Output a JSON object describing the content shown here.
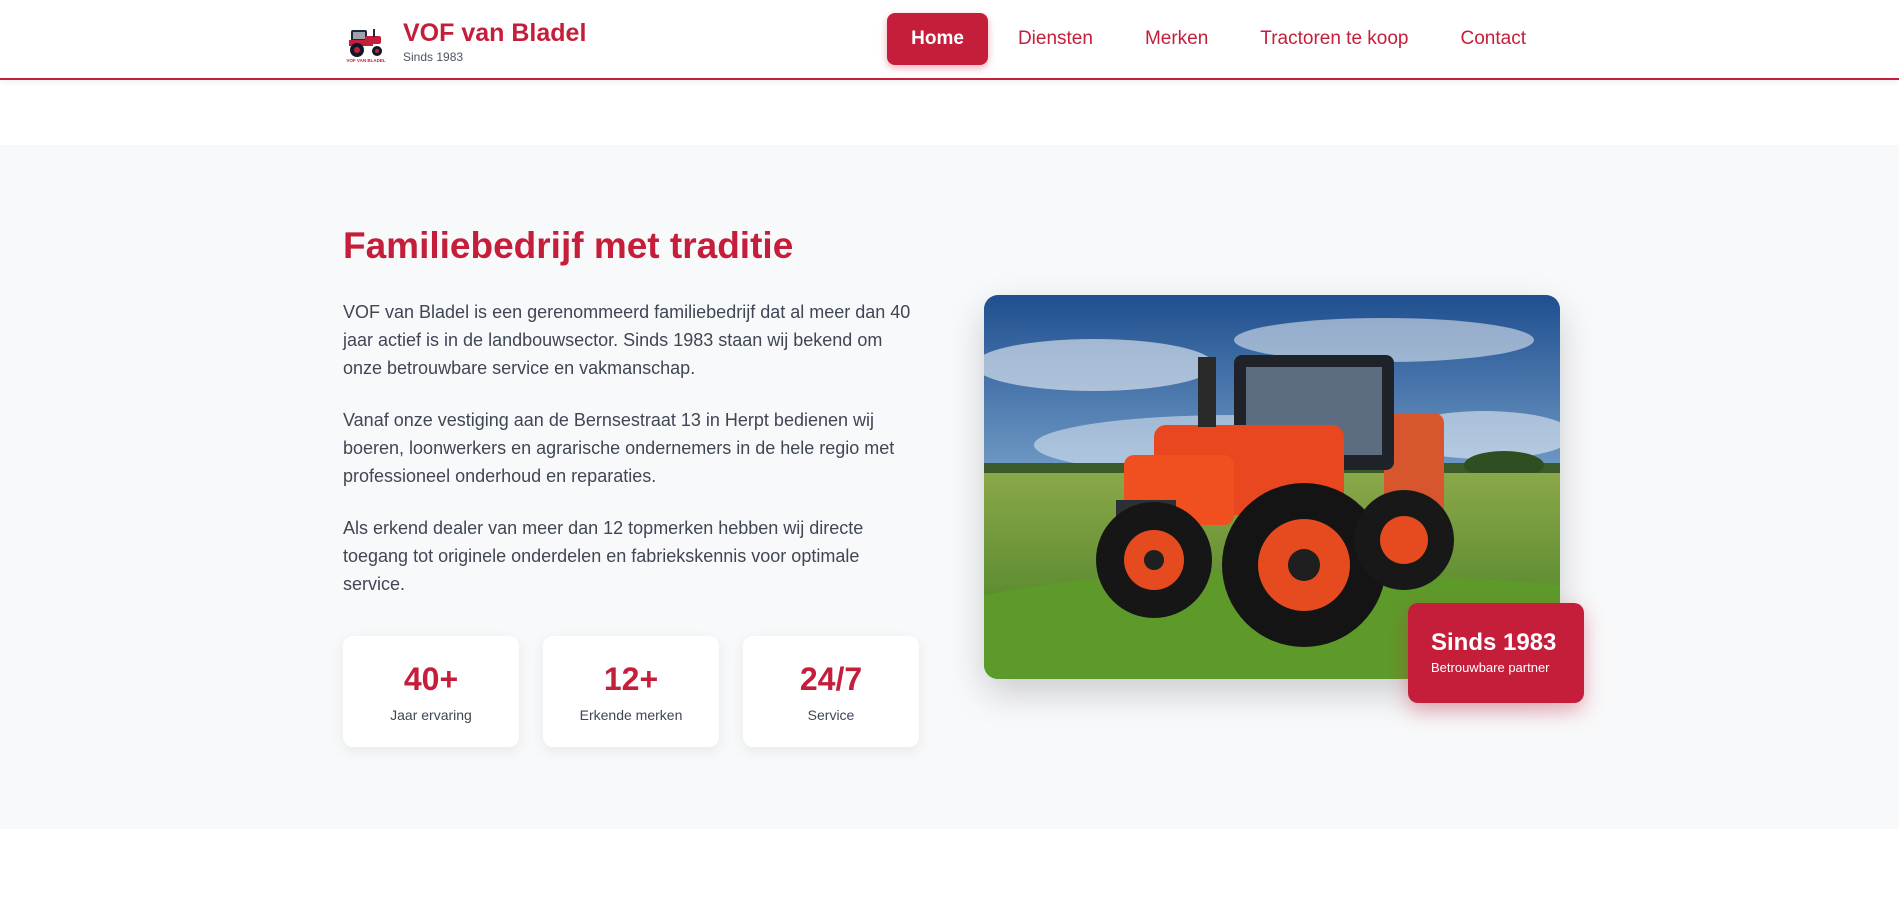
{
  "brand": {
    "name": "VOF van Bladel",
    "since": "Sinds 1983",
    "logo_caption": "VOF VAN BLADEL"
  },
  "nav": {
    "items": [
      {
        "label": "Home",
        "active": true
      },
      {
        "label": "Diensten",
        "active": false
      },
      {
        "label": "Merken",
        "active": false
      },
      {
        "label": "Tractoren te koop",
        "active": false
      },
      {
        "label": "Contact",
        "active": false
      }
    ]
  },
  "about": {
    "title": "Familiebedrijf met traditie",
    "paragraphs": [
      "VOF van Bladel is een gerenommeerd familiebedrijf dat al meer dan 40 jaar actief is in de landbouwsector. Sinds 1983 staan wij bekend om onze betrouwbare service en vakmanschap.",
      "Vanaf onze vestiging aan de Bernsestraat 13 in Herpt bedienen wij boeren, loonwerkers en agrarische ondernemers in de hele regio met professioneel onderhoud en reparaties.",
      "Als erkend dealer van meer dan 12 topmerken hebben wij directe toegang tot originele onderdelen en fabriekskennis voor optimale service."
    ],
    "stats": [
      {
        "value": "40+",
        "label": "Jaar ervaring"
      },
      {
        "value": "12+",
        "label": "Erkende merken"
      },
      {
        "value": "24/7",
        "label": "Service"
      }
    ],
    "badge": {
      "title": "Sinds 1983",
      "subtitle": "Betrouwbare partner"
    }
  },
  "colors": {
    "accent": "#c41e3a",
    "section_bg": "#f8f9fa",
    "text": "#3f4654"
  }
}
